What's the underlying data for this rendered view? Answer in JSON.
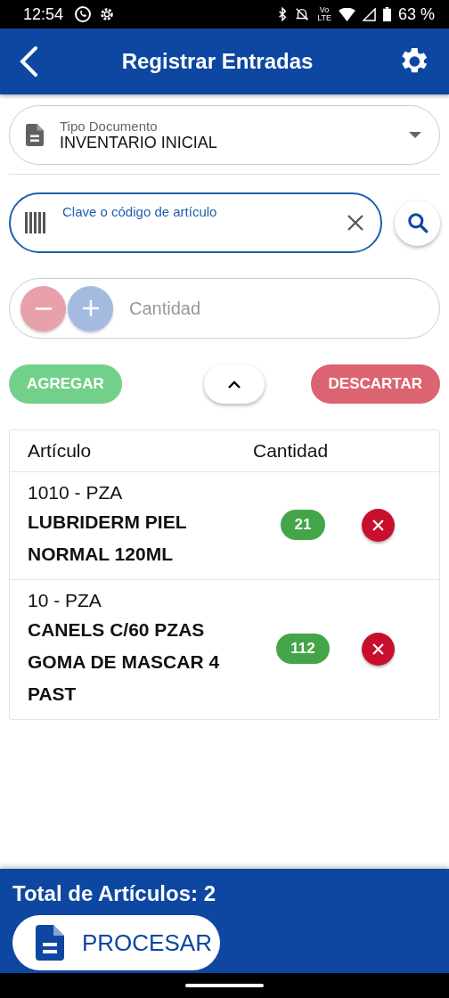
{
  "status_bar": {
    "time": "12:54",
    "network": {
      "line_1": "Vo",
      "line_2": "LTE"
    },
    "battery": "63 %"
  },
  "app_bar": {
    "title": "Registrar Entradas"
  },
  "document_type": {
    "label": "Tipo Documento",
    "value": "INVENTARIO INICIAL"
  },
  "article_search": {
    "placeholder": "Clave o código de artículo"
  },
  "quantity": {
    "placeholder": "Cantidad"
  },
  "actions": {
    "add": "AGREGAR",
    "discard": "DESCARTAR"
  },
  "table": {
    "columns": [
      "Artículo",
      "Cantidad"
    ],
    "rows": [
      {
        "code": "1010 - PZA",
        "name": "LUBRIDERM PIEL NORMAL 120ML",
        "quantity": "21"
      },
      {
        "code": "10 - PZA",
        "name": "CANELS C/60 PZAS GOMA DE MASCAR 4 PAST",
        "quantity": "112"
      }
    ]
  },
  "footer": {
    "total": "Total de Artículos: 2",
    "process": "PROCESAR"
  }
}
